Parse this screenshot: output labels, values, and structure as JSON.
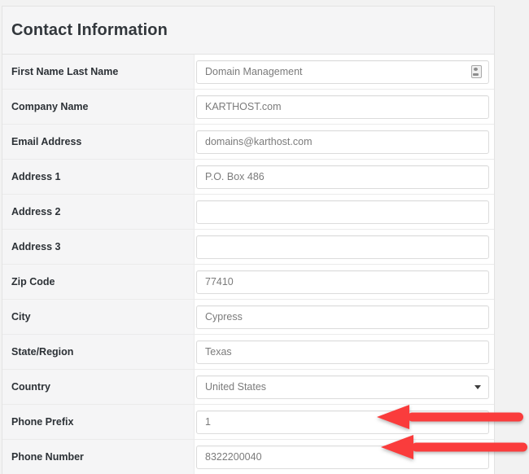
{
  "panel": {
    "title": "Contact Information"
  },
  "form": {
    "rows": [
      {
        "label": "First Name Last Name",
        "value": "Domain Management",
        "type": "text",
        "icon": "contact-card-icon",
        "name": "first-name-last-name"
      },
      {
        "label": "Company Name",
        "value": "KARTHOST.com",
        "type": "text",
        "name": "company-name"
      },
      {
        "label": "Email Address",
        "value": "domains@karthost.com",
        "type": "text",
        "name": "email-address"
      },
      {
        "label": "Address 1",
        "value": "P.O. Box 486",
        "type": "text",
        "name": "address-1"
      },
      {
        "label": "Address 2",
        "value": "",
        "type": "text",
        "name": "address-2"
      },
      {
        "label": "Address 3",
        "value": "",
        "type": "text",
        "name": "address-3"
      },
      {
        "label": "Zip Code",
        "value": "77410",
        "type": "text",
        "name": "zip-code"
      },
      {
        "label": "City",
        "value": "Cypress",
        "type": "text",
        "name": "city"
      },
      {
        "label": "State/Region",
        "value": "Texas",
        "type": "text",
        "name": "state-region"
      },
      {
        "label": "Country",
        "value": "United States",
        "type": "select",
        "name": "country"
      },
      {
        "label": "Phone Prefix",
        "value": "1",
        "type": "text",
        "name": "phone-prefix"
      },
      {
        "label": "Phone Number",
        "value": "8322200040",
        "type": "text",
        "name": "phone-number"
      }
    ]
  },
  "annotations": {
    "color": "#fa3c3c",
    "arrows": [
      {
        "name": "arrow-phone-prefix",
        "points_to": "phone-prefix",
        "direction": "left"
      },
      {
        "name": "arrow-phone-number",
        "points_to": "phone-number",
        "direction": "left"
      }
    ]
  },
  "colors": {
    "page_background": "#f2f2f2",
    "panel_background": "#ffffff",
    "label_column_background": "#f5f5f6",
    "border": "#e3e3e3",
    "label_text": "#2c3136",
    "input_text": "#7b7b7b",
    "annotation_red": "#fa3c3c"
  }
}
